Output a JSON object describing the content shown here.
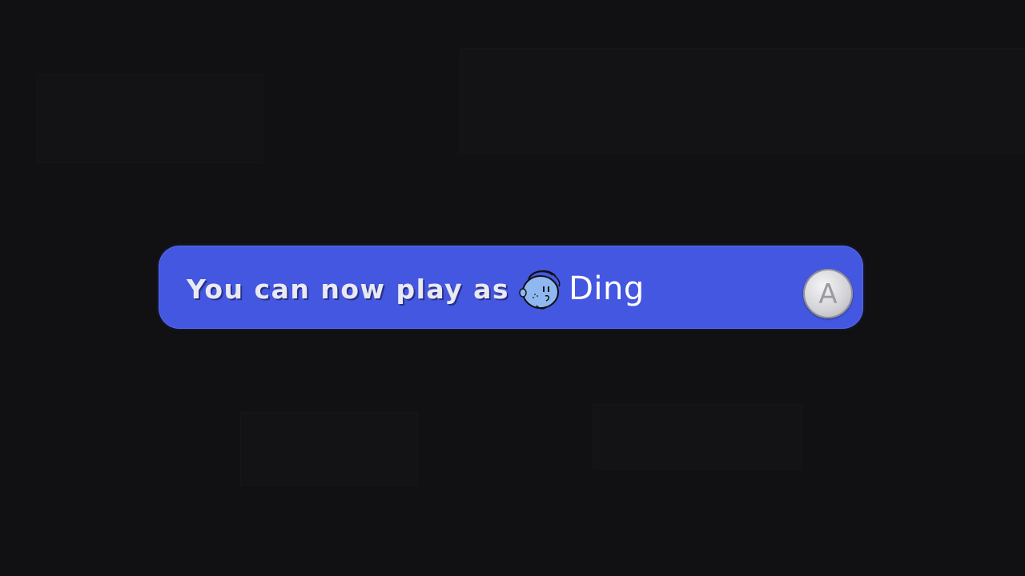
{
  "notification": {
    "message": "You can now play as",
    "character_icon": "character-face-icon",
    "character_name": "Ding",
    "confirm_button_label": "A"
  },
  "colors": {
    "background": "#111012",
    "banner": "#4457e0",
    "message_text": "#e9e9f2",
    "name_text": "#ffffff",
    "icon_face": "#8fb8f0"
  }
}
